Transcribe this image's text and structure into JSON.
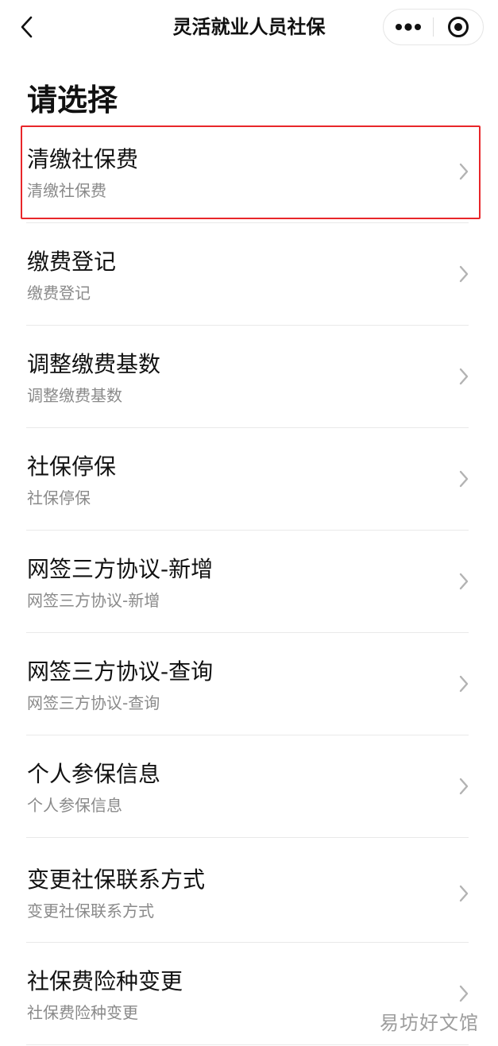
{
  "navbar": {
    "title": "灵活就业人员社保",
    "icons": [
      "chevron-left-icon",
      "more-dots-icon",
      "target-circle-icon"
    ]
  },
  "heading": "请选择",
  "items": [
    {
      "title": "清缴社保费",
      "subtitle": "清缴社保费"
    },
    {
      "title": "缴费登记",
      "subtitle": "缴费登记"
    },
    {
      "title": "调整缴费基数",
      "subtitle": "调整缴费基数"
    },
    {
      "title": "社保停保",
      "subtitle": "社保停保"
    },
    {
      "title": "网签三方协议-新增",
      "subtitle": "网签三方协议-新增"
    },
    {
      "title": "网签三方协议-查询",
      "subtitle": "网签三方协议-查询"
    },
    {
      "title": "个人参保信息",
      "subtitle": "个人参保信息"
    },
    {
      "title": "变更社保联系方式",
      "subtitle": "变更社保联系方式"
    },
    {
      "title": "社保费险种变更",
      "subtitle": "社保费险种变更"
    }
  ],
  "highlight": {
    "item_index": 0,
    "color": "#e8262a"
  },
  "watermark": "易坊好文馆"
}
